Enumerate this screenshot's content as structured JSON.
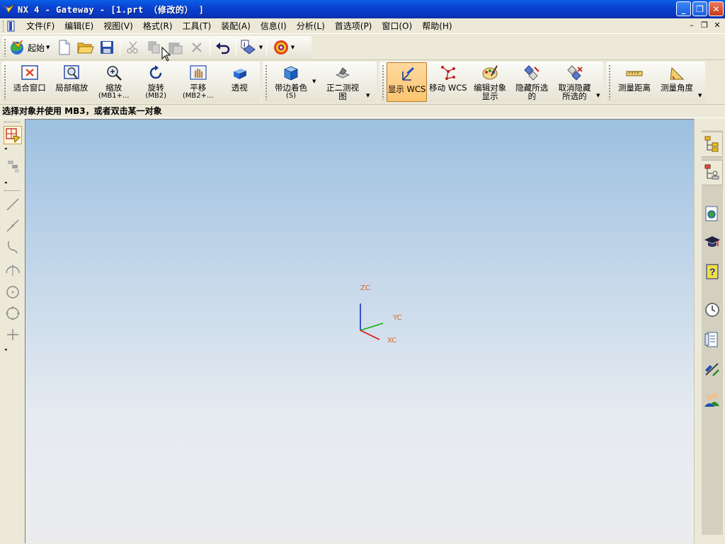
{
  "window": {
    "title": "NX 4 - Gateway - [1.prt （修改的） ]",
    "controls": {
      "minimize": "_",
      "maximize": "❐",
      "close": "✕"
    }
  },
  "menubar": {
    "items": [
      "文件(F)",
      "编辑(E)",
      "视图(V)",
      "格式(R)",
      "工具(T)",
      "装配(A)",
      "信息(I)",
      "分析(L)",
      "首选项(P)",
      "窗口(O)",
      "帮助(H)"
    ],
    "mdi_controls": [
      "–",
      "❐",
      "✕"
    ]
  },
  "toolbar_standard": {
    "start_label": "起始",
    "buttons": [
      "new-icon",
      "open-icon",
      "save-icon",
      "cut-icon",
      "copy-icon",
      "paste-icon",
      "delete-icon",
      "undo-icon",
      "info-icon",
      "palette-icon"
    ]
  },
  "toolbar_view": {
    "buttons": [
      {
        "label": "适合窗口",
        "sub": ""
      },
      {
        "label": "局部缩放",
        "sub": ""
      },
      {
        "label": "缩放",
        "sub": "(MB1+..."
      },
      {
        "label": "旋转",
        "sub": "(MB2)"
      },
      {
        "label": "平移",
        "sub": "(MB2+..."
      },
      {
        "label": "透视",
        "sub": ""
      },
      {
        "label": "带边着色",
        "sub": "(S)"
      },
      {
        "label": "正二测视",
        "sub": "图"
      },
      {
        "label": "显示 WCS",
        "sub": ""
      },
      {
        "label": "移动 WCS",
        "sub": ""
      },
      {
        "label": "编辑对象",
        "sub": "显示"
      },
      {
        "label": "隐藏所选",
        "sub": "的"
      },
      {
        "label": "取消隐藏",
        "sub": "所选的"
      },
      {
        "label": "测量距离",
        "sub": ""
      },
      {
        "label": "测量角度",
        "sub": ""
      }
    ]
  },
  "cue_line": "选择对象并使用 MB3，或者双击某一对象",
  "wcs": {
    "z_label": "ZC",
    "y_label": "YC",
    "x_label": "XC"
  },
  "colors": {
    "axis_label": "#e06020",
    "x_axis": "#e01010",
    "y_axis": "#10b010",
    "z_axis": "#1030c0",
    "active_button": "#fcc46e"
  }
}
